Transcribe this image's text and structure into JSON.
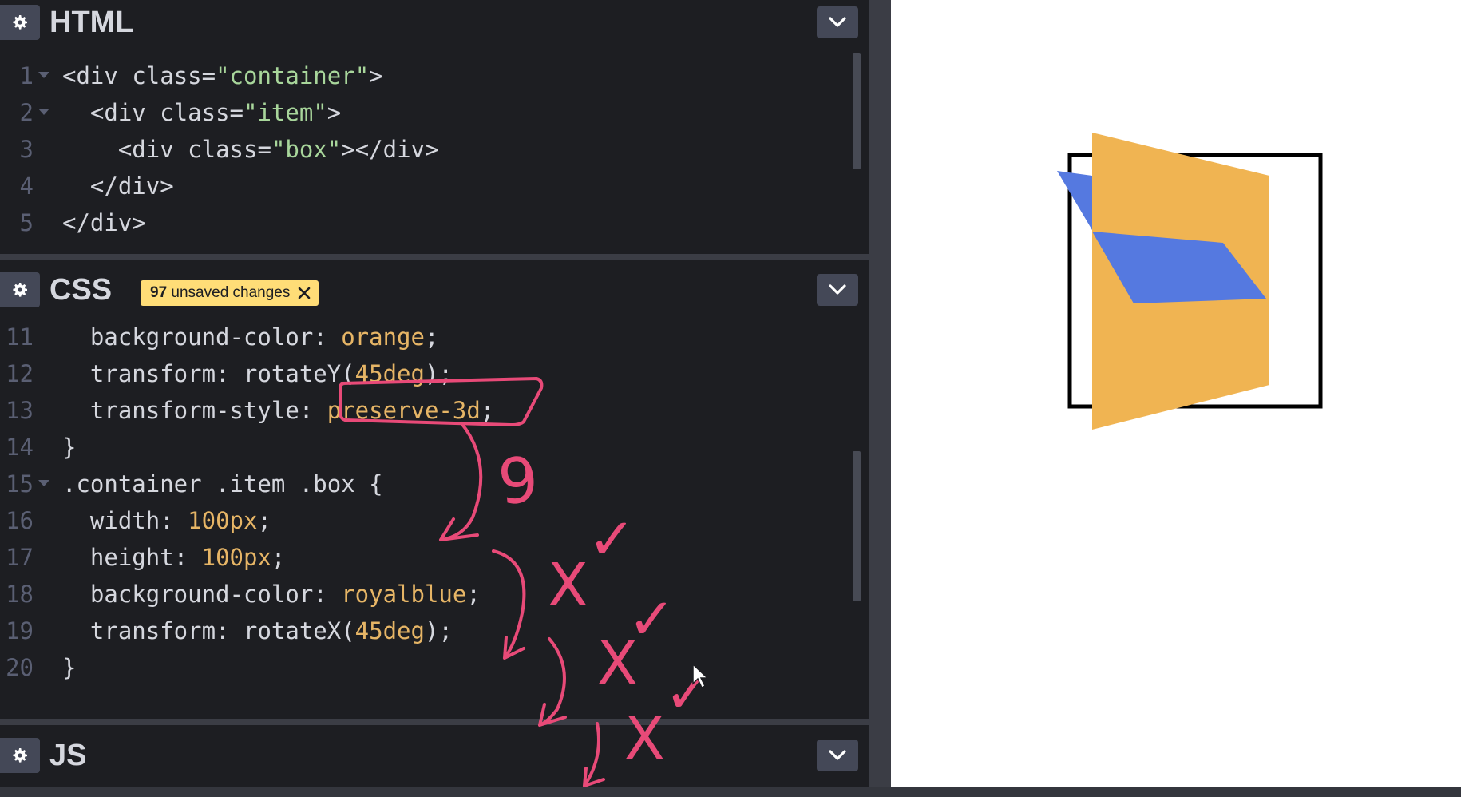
{
  "html_panel": {
    "title": "HTML",
    "lines": [
      {
        "n": "1",
        "fold": true,
        "indent": "",
        "parts": [
          [
            "tag",
            "<div "
          ],
          [
            "tag",
            "class"
          ],
          [
            "plain",
            "="
          ],
          [
            "str",
            "\"container\""
          ],
          [
            "tag",
            ">"
          ]
        ]
      },
      {
        "n": "2",
        "fold": true,
        "indent": "  ",
        "parts": [
          [
            "tag",
            "<div "
          ],
          [
            "tag",
            "class"
          ],
          [
            "plain",
            "="
          ],
          [
            "str",
            "\"item\""
          ],
          [
            "tag",
            ">"
          ]
        ]
      },
      {
        "n": "3",
        "fold": false,
        "indent": "    ",
        "parts": [
          [
            "tag",
            "<div "
          ],
          [
            "tag",
            "class"
          ],
          [
            "plain",
            "="
          ],
          [
            "str",
            "\"box\""
          ],
          [
            "tag",
            "></div>"
          ]
        ]
      },
      {
        "n": "4",
        "fold": false,
        "indent": "  ",
        "parts": [
          [
            "tag",
            "</div>"
          ]
        ]
      },
      {
        "n": "5",
        "fold": false,
        "indent": "",
        "parts": [
          [
            "tag",
            "</div>"
          ]
        ]
      }
    ]
  },
  "css_panel": {
    "title": "CSS",
    "badge": {
      "count": "97",
      "text": "unsaved changes"
    },
    "lines": [
      {
        "n": "11",
        "fold": false,
        "indent": "  ",
        "parts": [
          [
            "prop",
            "background-color"
          ],
          [
            "plain",
            ": "
          ],
          [
            "val",
            "orange"
          ],
          [
            "plain",
            ";"
          ]
        ]
      },
      {
        "n": "12",
        "fold": false,
        "indent": "  ",
        "parts": [
          [
            "prop",
            "transform"
          ],
          [
            "plain",
            ": "
          ],
          [
            "plain",
            "rotateY("
          ],
          [
            "num",
            "45deg"
          ],
          [
            "plain",
            ");"
          ]
        ]
      },
      {
        "n": "13",
        "fold": false,
        "indent": "  ",
        "parts": [
          [
            "prop",
            "transform-style"
          ],
          [
            "plain",
            ": "
          ],
          [
            "val",
            "preserve-3d"
          ],
          [
            "plain",
            ";"
          ]
        ]
      },
      {
        "n": "14",
        "fold": false,
        "indent": "",
        "parts": [
          [
            "plain",
            "}"
          ]
        ]
      },
      {
        "n": "15",
        "fold": true,
        "indent": "",
        "parts": [
          [
            "selector",
            ".container .item .box"
          ],
          [
            "plain",
            " {"
          ]
        ]
      },
      {
        "n": "16",
        "fold": false,
        "indent": "  ",
        "parts": [
          [
            "prop",
            "width"
          ],
          [
            "plain",
            ": "
          ],
          [
            "num",
            "100px"
          ],
          [
            "plain",
            ";"
          ]
        ]
      },
      {
        "n": "17",
        "fold": false,
        "indent": "  ",
        "parts": [
          [
            "prop",
            "height"
          ],
          [
            "plain",
            ": "
          ],
          [
            "num",
            "100px"
          ],
          [
            "plain",
            ";"
          ]
        ]
      },
      {
        "n": "18",
        "fold": false,
        "indent": "  ",
        "parts": [
          [
            "prop",
            "background-color"
          ],
          [
            "plain",
            ": "
          ],
          [
            "val",
            "royalblue"
          ],
          [
            "plain",
            ";"
          ]
        ]
      },
      {
        "n": "19",
        "fold": false,
        "indent": "  ",
        "parts": [
          [
            "prop",
            "transform"
          ],
          [
            "plain",
            ": "
          ],
          [
            "plain",
            "rotateX("
          ],
          [
            "num",
            "45deg"
          ],
          [
            "plain",
            ");"
          ]
        ]
      },
      {
        "n": "20",
        "fold": false,
        "indent": "",
        "parts": [
          [
            "plain",
            "}"
          ]
        ]
      }
    ]
  },
  "js_panel": {
    "title": "JS"
  },
  "annotation": {
    "digit": "9",
    "cross": "X",
    "check": "✓"
  },
  "colors": {
    "annotation": "#e84a78",
    "orange_face": "#f0b452",
    "blue_face": "#5579e0",
    "tag": "#d5d7de",
    "string": "#a8d69b",
    "value": "#e6b566"
  },
  "icons": [
    "gear-icon",
    "chevron-down-icon",
    "close-icon",
    "cursor-icon"
  ]
}
